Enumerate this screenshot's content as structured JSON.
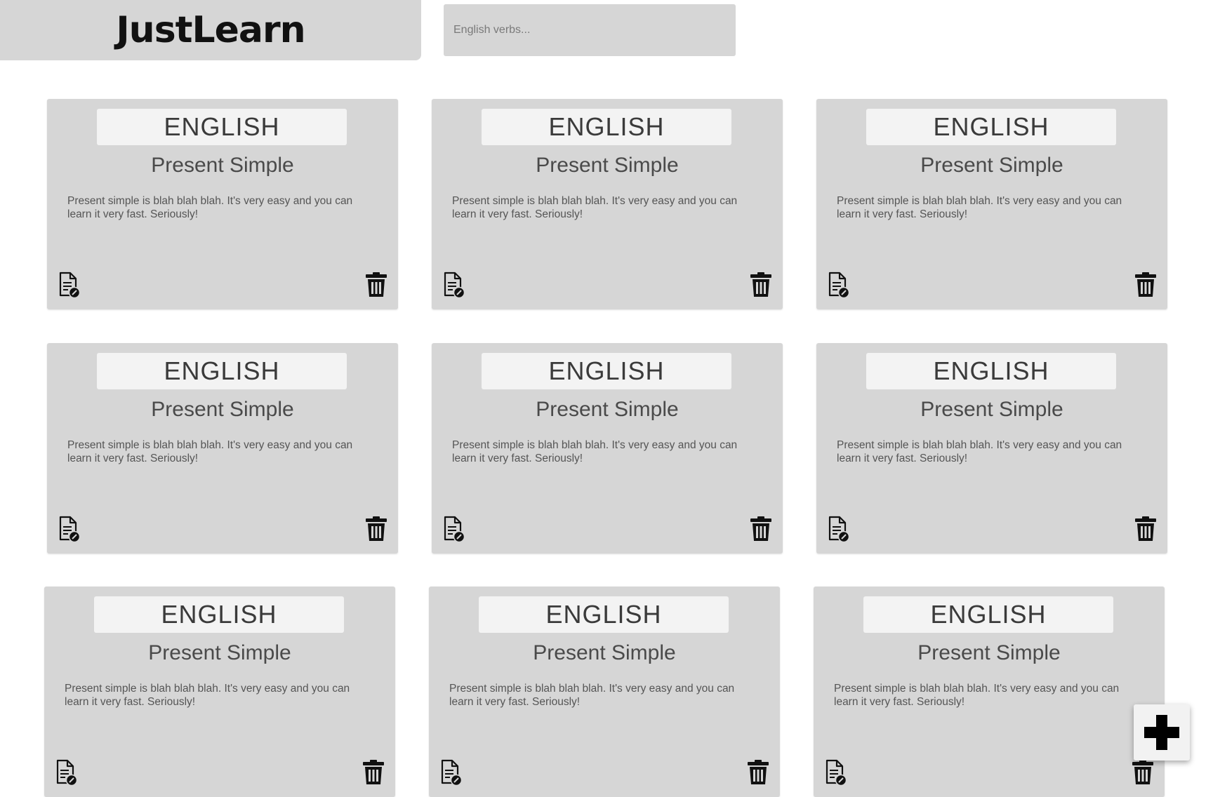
{
  "app": {
    "logo": "JustLearn"
  },
  "search": {
    "placeholder": "English verbs..."
  },
  "cards": [
    {
      "language": "ENGLISH",
      "title": "Present Simple",
      "description": "Present simple is blah blah blah. It's very easy and you can learn it very fast. Seriously!"
    },
    {
      "language": "ENGLISH",
      "title": "Present Simple",
      "description": "Present simple is blah blah blah. It's very easy and you can learn it very fast. Seriously!"
    },
    {
      "language": "ENGLISH",
      "title": "Present Simple",
      "description": "Present simple is blah blah blah. It's very easy and you can learn it very fast. Seriously!"
    },
    {
      "language": "ENGLISH",
      "title": "Present Simple",
      "description": "Present simple is blah blah blah. It's very easy and you can learn it very fast. Seriously!"
    },
    {
      "language": "ENGLISH",
      "title": "Present Simple",
      "description": "Present simple is blah blah blah. It's very easy and you can learn it very fast. Seriously!"
    },
    {
      "language": "ENGLISH",
      "title": "Present Simple",
      "description": "Present simple is blah blah blah. It's very easy and you can learn it very fast. Seriously!"
    },
    {
      "language": "ENGLISH",
      "title": "Present Simple",
      "description": "Present simple is blah blah blah. It's very easy and you can learn it very fast. Seriously!"
    },
    {
      "language": "ENGLISH",
      "title": "Present Simple",
      "description": "Present simple is blah blah blah. It's very easy and you can learn it very fast. Seriously!"
    },
    {
      "language": "ENGLISH",
      "title": "Present Simple",
      "description": "Present simple is blah blah blah. It's very easy and you can learn it very fast. Seriously!"
    }
  ],
  "icons": {
    "edit": "edit-document-icon",
    "delete": "trash-icon",
    "add": "plus-icon"
  },
  "colors": {
    "panel": "#d6d6d6",
    "pill": "#f3f3f3",
    "icon": "#111111",
    "page": "#ffffff"
  }
}
